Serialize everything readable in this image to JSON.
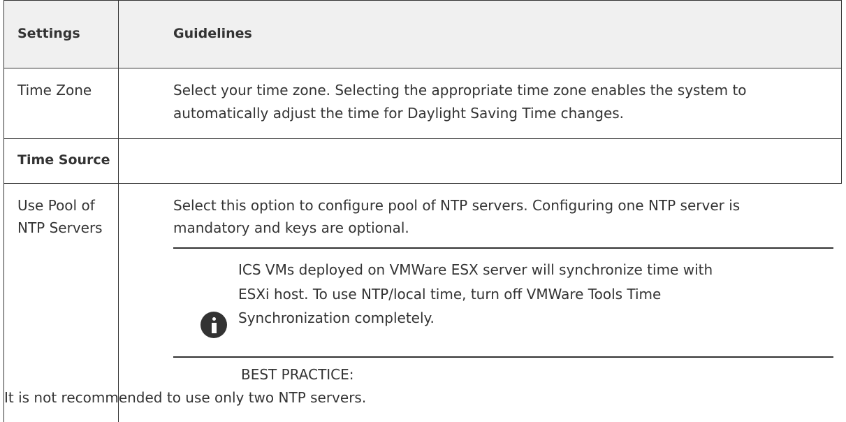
{
  "table": {
    "header": {
      "settings": "Settings",
      "guidelines": "Guidelines"
    },
    "rows": {
      "time_zone": {
        "setting": "Time Zone",
        "guideline_line1": "Select your time zone. Selecting the appropriate time zone enables the system to",
        "guideline_line2": "automatically adjust the time for Daylight Saving Time changes."
      },
      "time_source": {
        "heading": "Time Source"
      },
      "ntp_pool": {
        "setting_line1": "Use Pool of",
        "setting_line2": "NTP Servers",
        "guideline_line1": "Select this option to configure pool of NTP servers. Configuring one NTP server is",
        "guideline_line2": "mandatory and keys are optional."
      }
    },
    "note": {
      "icon": "info-icon",
      "line1": "ICS VMs deployed on VMWare ESX server will synchronize time with",
      "line2": "ESXi host. To use NTP/local time, turn off VMWare Tools Time",
      "line3": "Synchronization completely."
    },
    "best_practice": {
      "label": "BEST PRACTICE:",
      "text": "It is not recommended to use only two NTP servers."
    }
  }
}
